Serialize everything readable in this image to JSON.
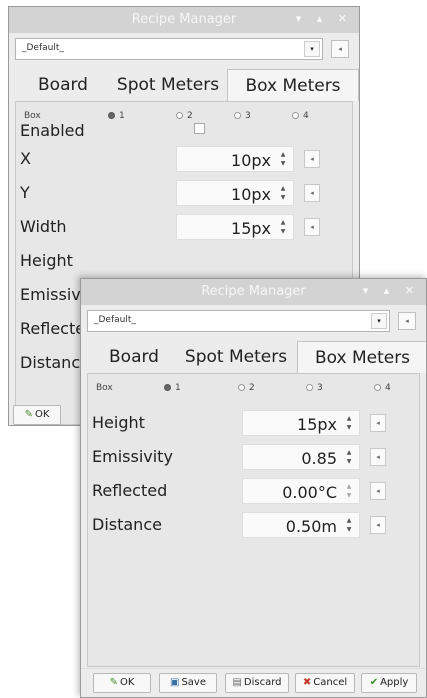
{
  "windows": [
    {
      "title": "Recipe Manager",
      "controls": "▾ ▴ ✕",
      "preset": {
        "value": "_Default_",
        "arrow": "▾",
        "button": "◂"
      },
      "tabs": [
        "Board",
        "Spot Meters",
        "Box Meters"
      ],
      "box_label": "Box",
      "box_options": [
        "1",
        "2",
        "3",
        "4"
      ],
      "enabled_label": "Enabled",
      "fields": [
        {
          "label": "X",
          "value": "10px"
        },
        {
          "label": "Y",
          "value": "10px"
        },
        {
          "label": "Width",
          "value": "15px"
        },
        {
          "label": "Height",
          "value": ""
        },
        {
          "label": "Emissivity",
          "value": ""
        },
        {
          "label": "Reflected",
          "value": ""
        },
        {
          "label": "Distance",
          "value": ""
        }
      ],
      "ok_label": "OK"
    },
    {
      "title": "Recipe Manager",
      "controls": "▾ ▴ ✕",
      "preset": {
        "value": "_Default_",
        "arrow": "▾",
        "button": "◂"
      },
      "tabs": [
        "Board",
        "Spot Meters",
        "Box Meters"
      ],
      "box_label": "Box",
      "box_options": [
        "1",
        "2",
        "3",
        "4"
      ],
      "fields": [
        {
          "label": "Height",
          "value": "15px"
        },
        {
          "label": "Emissivity",
          "value": "0.85"
        },
        {
          "label": "Reflected",
          "value": "0.00°C"
        },
        {
          "label": "Distance",
          "value": "0.50m"
        }
      ],
      "buttons": [
        "OK",
        "Save",
        "Discard",
        "Cancel",
        "Apply"
      ],
      "button_icons": [
        "✎",
        "💾",
        "📋",
        "✖",
        "✔"
      ]
    }
  ],
  "colors": {
    "ok_icon": "#4a8a2a",
    "save_icon": "#3a6ea5",
    "cancel_icon": "#c0392b",
    "apply_icon": "#3c8d2f"
  }
}
